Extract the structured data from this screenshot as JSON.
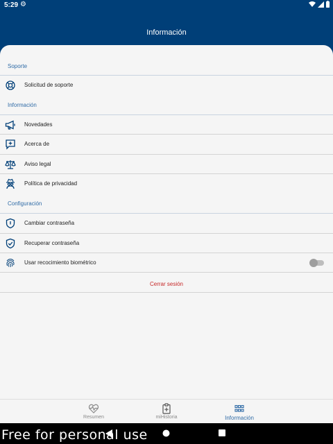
{
  "status": {
    "time": "5:29"
  },
  "header": {
    "title": "Información"
  },
  "sections": {
    "support": {
      "title": "Soporte",
      "items": [
        {
          "label": "Solicitud de soporte",
          "icon": "lifebuoy-icon"
        }
      ]
    },
    "info": {
      "title": "Información",
      "items": [
        {
          "label": "Novedades",
          "icon": "megaphone-icon"
        },
        {
          "label": "Acerca de",
          "icon": "message-plus-icon"
        },
        {
          "label": "Aviso legal",
          "icon": "scales-icon"
        },
        {
          "label": "Política de privacidad",
          "icon": "spy-icon"
        }
      ]
    },
    "config": {
      "title": "Configuración",
      "items": [
        {
          "label": "Cambiar contraseña",
          "icon": "shield-icon"
        },
        {
          "label": "Recuperar contraseña",
          "icon": "shield-check-icon"
        },
        {
          "label": "Usar recocimiento biométrico",
          "icon": "fingerprint-icon",
          "toggle_on": false
        }
      ]
    }
  },
  "logout": {
    "label": "Cerrar sesión"
  },
  "tabs": [
    {
      "label": "Resumen",
      "icon": "heart-pulse-icon",
      "active": false
    },
    {
      "label": "miHistoria",
      "icon": "clipboard-plus-icon",
      "active": false
    },
    {
      "label": "Información",
      "icon": "grid-icon",
      "active": true
    }
  ],
  "watermark": "Free for personal use",
  "colors": {
    "primary": "#003f78",
    "accent": "#2f6ba6",
    "danger": "#c62828",
    "background": "#f5f5f5"
  }
}
